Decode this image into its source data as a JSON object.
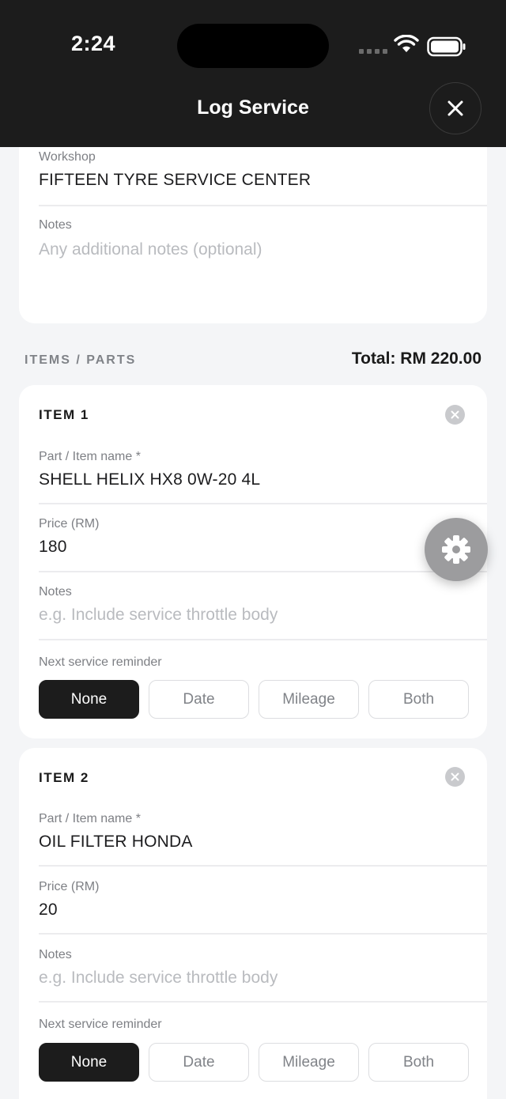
{
  "status_bar": {
    "time": "2:24"
  },
  "header": {
    "title": "Log Service"
  },
  "workshop": {
    "label": "Workshop",
    "value": "FIFTEEN TYRE SERVICE CENTER"
  },
  "notes": {
    "label": "Notes",
    "placeholder": "Any additional notes (optional)"
  },
  "items_section": {
    "label": "ITEMS / PARTS",
    "total": "Total: RM 220.00"
  },
  "items": [
    {
      "title": "ITEM 1",
      "part_label": "Part / Item name *",
      "part_value": "SHELL HELIX HX8 0W-20 4L",
      "price_label": "Price (RM)",
      "price_value": "180",
      "notes_label": "Notes",
      "notes_placeholder": "e.g. Include service throttle body",
      "reminder_label": "Next service reminder",
      "reminder_options": [
        "None",
        "Date",
        "Mileage",
        "Both"
      ],
      "reminder_selected": "None"
    },
    {
      "title": "ITEM 2",
      "part_label": "Part / Item name *",
      "part_value": "OIL FILTER HONDA",
      "price_label": "Price (RM)",
      "price_value": "20",
      "notes_label": "Notes",
      "notes_placeholder": "e.g. Include service throttle body",
      "reminder_label": "Next service reminder",
      "reminder_options": [
        "None",
        "Date",
        "Mileage",
        "Both"
      ],
      "reminder_selected": "None"
    }
  ],
  "icons": {
    "close": "close-icon",
    "remove": "close-circle-icon",
    "fab": "gear-icon",
    "wifi": "wifi-icon",
    "battery": "battery-icon"
  },
  "colors": {
    "header_bg": "#1c1c1c",
    "active_segment": "#1c1c1c",
    "page_bg": "#f4f5f7"
  }
}
